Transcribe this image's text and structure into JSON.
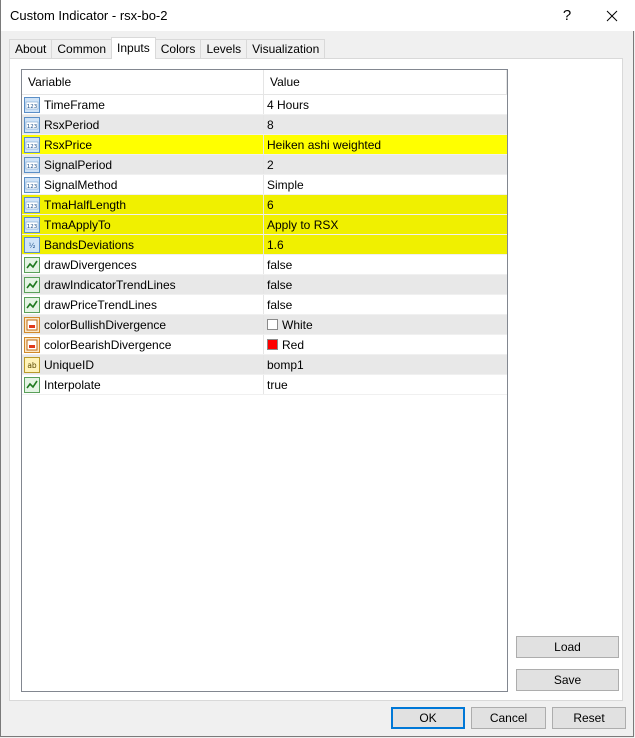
{
  "window": {
    "title": "Custom Indicator - rsx-bo-2",
    "help_label": "?",
    "close_icon": "close-icon"
  },
  "tabs": [
    {
      "label": "About"
    },
    {
      "label": "Common"
    },
    {
      "label": "Inputs",
      "active": true
    },
    {
      "label": "Colors"
    },
    {
      "label": "Levels"
    },
    {
      "label": "Visualization"
    }
  ],
  "grid": {
    "headers": {
      "variable": "Variable",
      "value": "Value"
    },
    "rows": [
      {
        "variable": "TimeFrame",
        "value": "4 Hours",
        "icon": "integer-icon",
        "style": "normal"
      },
      {
        "variable": "RsxPeriod",
        "value": "8",
        "icon": "integer-icon",
        "style": "alt"
      },
      {
        "variable": "RsxPrice",
        "value": "Heiken ashi weighted",
        "icon": "integer-icon",
        "style": "highlight"
      },
      {
        "variable": "SignalPeriod",
        "value": "2",
        "icon": "integer-icon",
        "style": "alt"
      },
      {
        "variable": "SignalMethod",
        "value": "Simple",
        "icon": "integer-icon",
        "style": "normal"
      },
      {
        "variable": "TmaHalfLength",
        "value": "6",
        "icon": "integer-icon",
        "style": "highlight2"
      },
      {
        "variable": "TmaApplyTo",
        "value": "Apply to RSX",
        "icon": "integer-icon",
        "style": "highlight2"
      },
      {
        "variable": "BandsDeviations",
        "value": "1.6",
        "icon": "double-icon",
        "style": "highlight2"
      },
      {
        "variable": "drawDivergences",
        "value": "false",
        "icon": "bool-icon",
        "style": "normal"
      },
      {
        "variable": "drawIndicatorTrendLines",
        "value": "false",
        "icon": "bool-icon",
        "style": "alt"
      },
      {
        "variable": "drawPriceTrendLines",
        "value": "false",
        "icon": "bool-icon",
        "style": "normal"
      },
      {
        "variable": "colorBullishDivergence",
        "value": "White",
        "icon": "color-icon",
        "style": "alt",
        "swatch": "#ffffff"
      },
      {
        "variable": "colorBearishDivergence",
        "value": "Red",
        "icon": "color-icon",
        "style": "normal",
        "swatch": "#ff0000"
      },
      {
        "variable": "UniqueID",
        "value": "bomp1",
        "icon": "string-icon",
        "style": "alt"
      },
      {
        "variable": "Interpolate",
        "value": "true",
        "icon": "bool-icon",
        "style": "normal"
      }
    ]
  },
  "buttons": {
    "load": "Load",
    "save": "Save",
    "ok": "OK",
    "cancel": "Cancel",
    "reset": "Reset"
  },
  "colors": {
    "highlight": "#ffff00",
    "highlight2": "#f0f000",
    "alt_row": "#e8e8e8",
    "focus_border": "#0078d7"
  }
}
